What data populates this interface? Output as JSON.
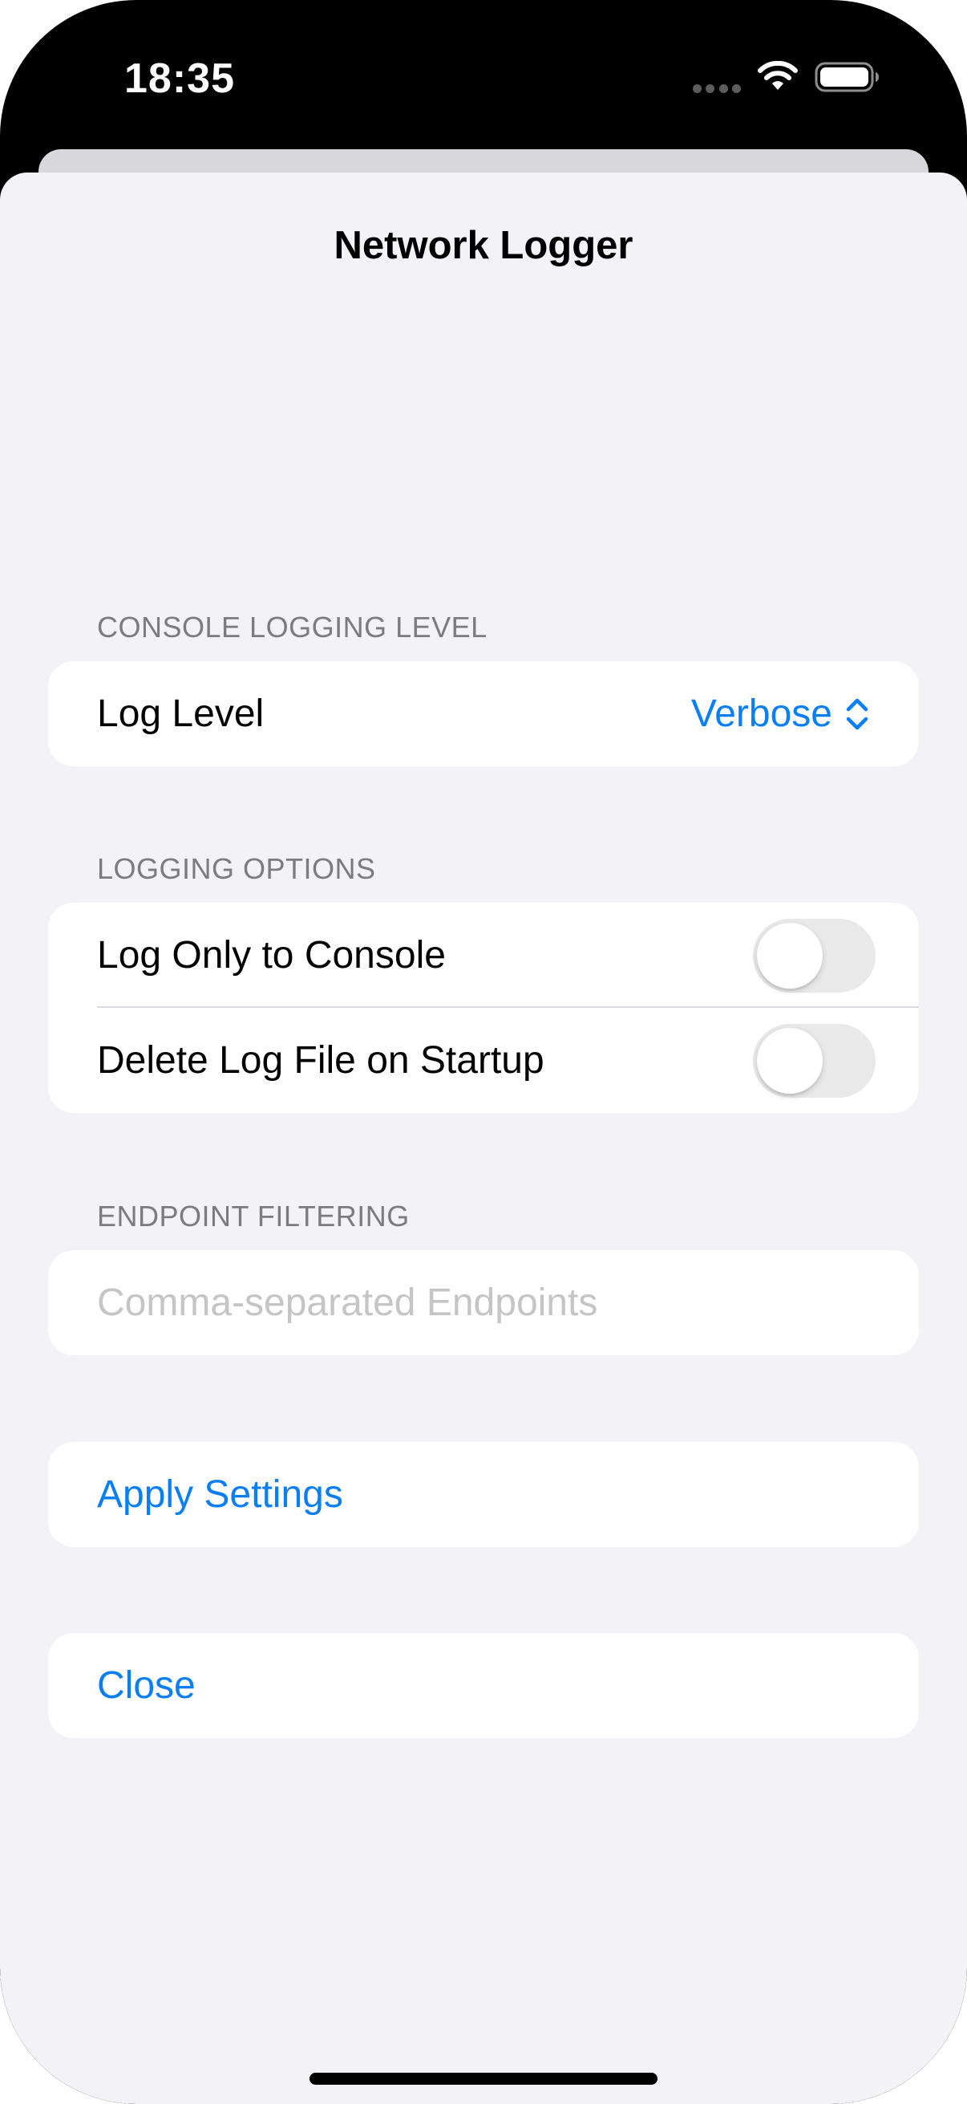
{
  "status_bar": {
    "time": "18:35",
    "icons": [
      "cellular-signal-icon",
      "wifi-icon",
      "battery-icon"
    ]
  },
  "sheet": {
    "title": "Network Logger"
  },
  "console_logging": {
    "header": "CONSOLE LOGGING LEVEL",
    "log_level_label": "Log Level",
    "log_level_value": "Verbose"
  },
  "logging_options": {
    "header": "LOGGING OPTIONS",
    "log_only_console_label": "Log Only to Console",
    "log_only_console_on": false,
    "delete_log_label": "Delete Log File on Startup",
    "delete_log_on": false
  },
  "endpoint_filtering": {
    "header": "ENDPOINT FILTERING",
    "input_value": "",
    "input_placeholder": "Comma-separated Endpoints"
  },
  "actions": {
    "apply_label": "Apply Settings",
    "close_label": "Close"
  },
  "colors": {
    "accent": "#0a7ff5",
    "background": "#f2f2f7",
    "toggle_off": "#e9e9ea"
  }
}
